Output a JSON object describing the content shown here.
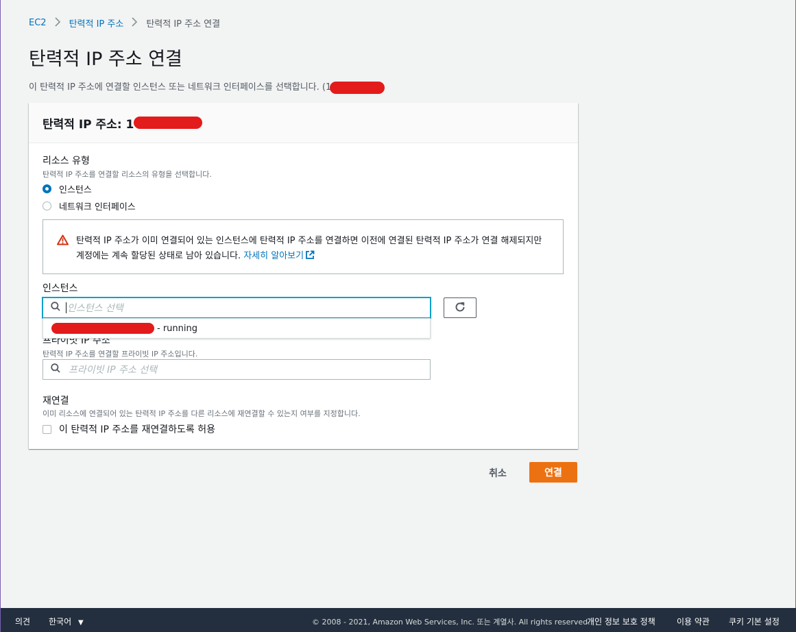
{
  "breadcrumb": {
    "root": "EC2",
    "parent": "탄력적 IP 주소",
    "current": "탄력적 IP 주소 연결"
  },
  "page": {
    "title": "탄력적 IP 주소 연결",
    "description": "이 탄력적 IP 주소에 연결할 인스턴스 또는 네트워크 인터페이스를 선택합니다. (1"
  },
  "panel": {
    "header": "탄력적 IP 주소: 1",
    "resource_type": {
      "label": "리소스 유형",
      "description": "탄력적 IP 주소를 연결할 리소스의 유형을 선택합니다.",
      "options": [
        "인스턴스",
        "네트워크 인터페이스"
      ],
      "selected": "인스턴스"
    },
    "alert": {
      "text": "탄력적 IP 주소가 이미 연결되어 있는 인스턴스에 탄력적 IP 주소를 연결하면 이전에 연결된 탄력적 IP 주소가 연결 해제되지만 계정에는 계속 할당된 상태로 남아 있습니다. ",
      "link": "자세히 알아보기"
    },
    "instance": {
      "label": "인스턴스",
      "placeholder": "인스턴스 선택",
      "dropdown_option": "- running"
    },
    "private_ip": {
      "label": "프라이빗 IP 주소",
      "description": "탄력적 IP 주소를 연결할 프라이빗 IP 주소입니다.",
      "placeholder": "프라이빗 IP 주소 선택"
    },
    "reassociate": {
      "label": "재연결",
      "description": "이미 리소스에 연결되어 있는 탄력적 IP 주소를 다른 리소스에 재연결할 수 있는지 여부를 지정합니다.",
      "checkbox": "이 탄력적 IP 주소를 재연결하도록 허용",
      "checked": false
    }
  },
  "actions": {
    "cancel": "취소",
    "associate": "연결"
  },
  "footer": {
    "feedback": "의견",
    "language": "한국어",
    "copyright": "© 2008 - 2021, Amazon Web Services, Inc. 또는 계열사. All rights reserved.",
    "privacy": "개인 정보 보호 정책",
    "terms": "이용 약관",
    "cookies": "쿠키 기본 설정"
  },
  "colors": {
    "link": "#0073bb",
    "primary": "#ec7211",
    "footer_bg": "#232f3e",
    "redaction": "#e31b1b"
  }
}
